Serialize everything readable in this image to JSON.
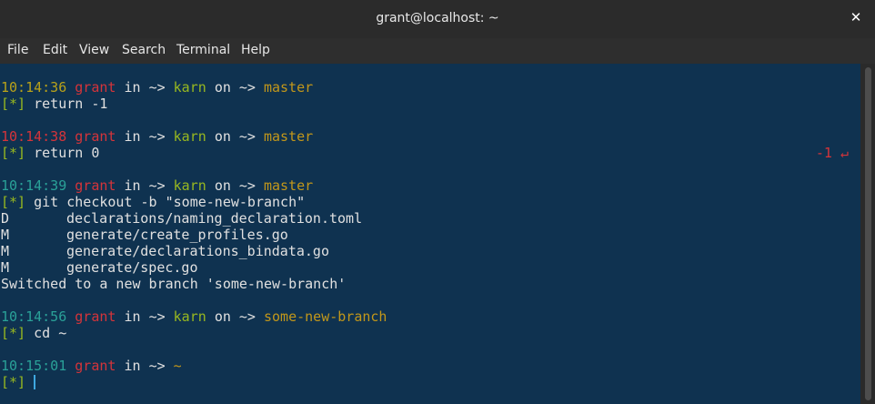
{
  "window": {
    "title": "grant@localhost: ~",
    "close_glyph": "✕"
  },
  "menu": {
    "items": [
      "File",
      "Edit",
      "View",
      "Search",
      "Terminal",
      "Help"
    ]
  },
  "terminal": {
    "prompts": [
      {
        "time": "10:14:36",
        "user": "grant",
        "in": "in",
        "arrow": "~>",
        "dir": "karn",
        "on": "on",
        "arrow2": "~>",
        "branch": "master",
        "marker": "[*]",
        "command": "return -1",
        "return_code": ""
      },
      {
        "time": "10:14:38",
        "user": "grant",
        "in": "in",
        "arrow": "~>",
        "dir": "karn",
        "on": "on",
        "arrow2": "~>",
        "branch": "master",
        "marker": "[*]",
        "command": "return 0",
        "return_code": "-1 ↵"
      },
      {
        "time": "10:14:39",
        "user": "grant",
        "in": "in",
        "arrow": "~>",
        "dir": "karn",
        "on": "on",
        "arrow2": "~>",
        "branch": "master",
        "marker": "[*]",
        "command": "git checkout -b \"some-new-branch\"",
        "return_code": ""
      },
      {
        "time": "10:14:56",
        "user": "grant",
        "in": "in",
        "arrow": "~>",
        "dir": "karn",
        "on": "on",
        "arrow2": "~>",
        "branch": "some-new-branch",
        "marker": "[*]",
        "command": "cd ~",
        "return_code": ""
      },
      {
        "time": "10:15:01",
        "user": "grant",
        "in": "in",
        "arrow": "~>",
        "dir": "~",
        "marker": "[*]",
        "command": ""
      }
    ],
    "output": {
      "files": [
        {
          "status": "D",
          "path": "declarations/naming_declaration.toml"
        },
        {
          "status": "M",
          "path": "generate/create_profiles.go"
        },
        {
          "status": "M",
          "path": "generate/declarations_bindata.go"
        },
        {
          "status": "M",
          "path": "generate/spec.go"
        }
      ],
      "switched": "Switched to a new branch 'some-new-branch'"
    }
  },
  "colors": {
    "background": "#0f3250",
    "time_first": "#b8a11a",
    "time_error": "#d5343a",
    "time_ok": "#2aa198",
    "user": "#d5343a",
    "dir": "#98b820",
    "branch": "#c2971a",
    "cursor": "#3fa8e0"
  }
}
